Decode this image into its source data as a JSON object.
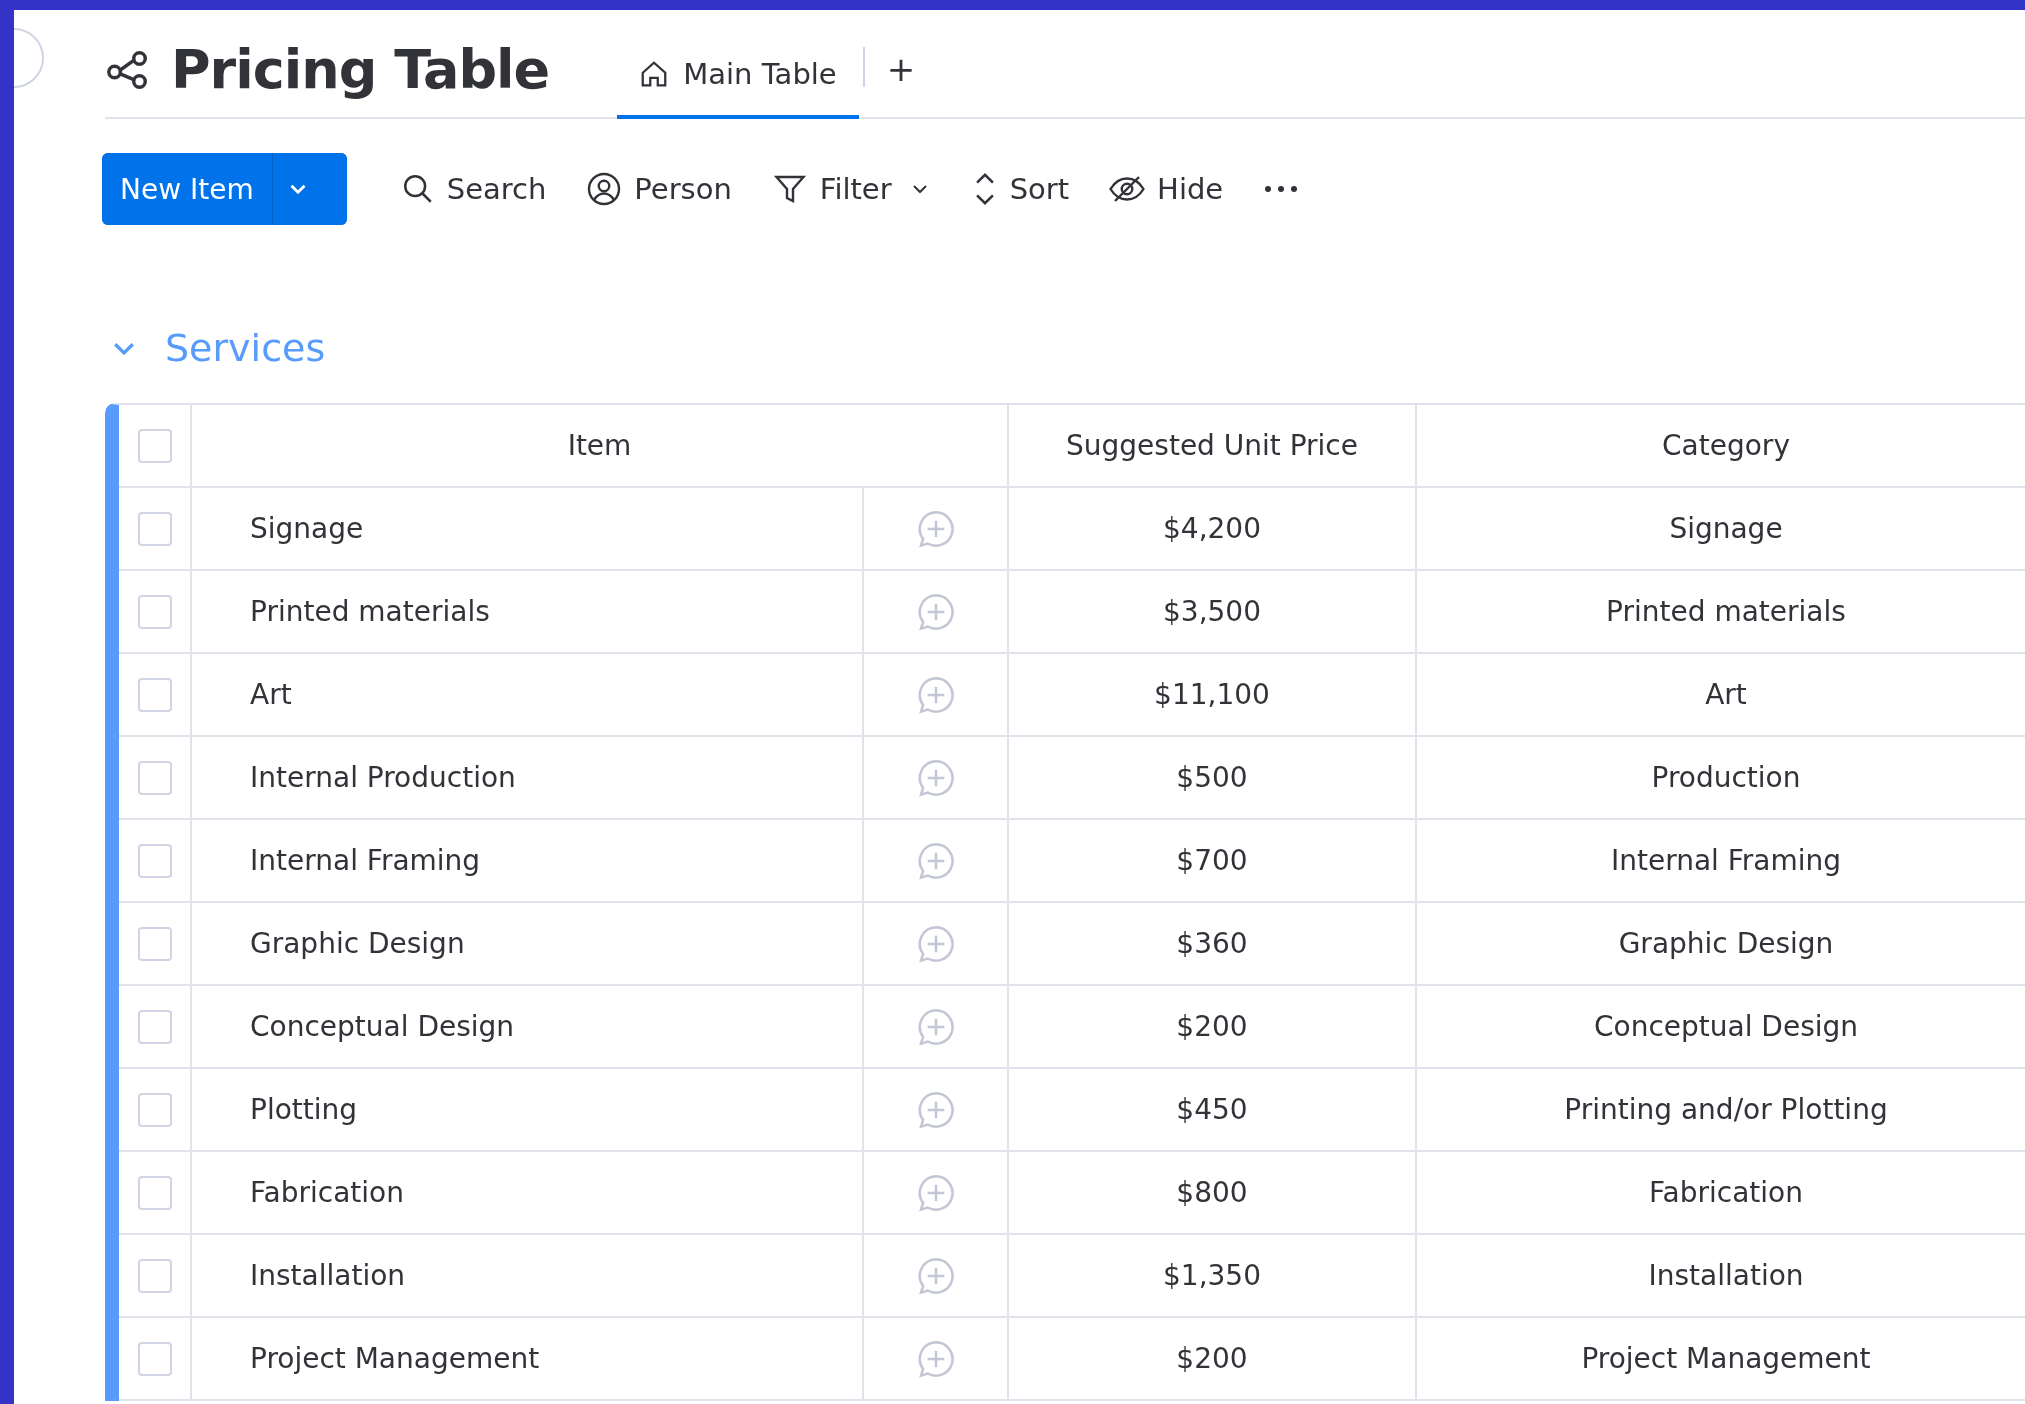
{
  "board": {
    "title": "Pricing Table"
  },
  "views": [
    {
      "label": "Main Table",
      "selected": true
    }
  ],
  "add_view": "+",
  "toolbar": {
    "new_item": "New Item",
    "tools": [
      {
        "kind": "search",
        "label": "Search"
      },
      {
        "kind": "person",
        "label": "Person"
      },
      {
        "kind": "filter",
        "label": "Filter"
      },
      {
        "kind": "sort",
        "label": "Sort"
      },
      {
        "kind": "hide",
        "label": "Hide"
      },
      {
        "kind": "more"
      }
    ]
  },
  "group": {
    "title": "Services",
    "expanded": true,
    "color": "#579bfc"
  },
  "table": {
    "select_all_checked": false,
    "columns": [
      "Item",
      "Suggested Unit Price",
      "Category"
    ],
    "rows": [
      {
        "item": "Signage",
        "price": "$4,200",
        "category": "Signage",
        "checked": false
      },
      {
        "item": "Printed materials",
        "price": "$3,500",
        "category": "Printed materials",
        "checked": false
      },
      {
        "item": "Art",
        "price": "$11,100",
        "category": "Art",
        "checked": false
      },
      {
        "item": "Internal Production",
        "price": "$500",
        "category": "Production",
        "checked": false
      },
      {
        "item": "Internal Framing",
        "price": "$700",
        "category": "Internal Framing",
        "checked": false
      },
      {
        "item": "Graphic Design",
        "price": "$360",
        "category": "Graphic Design",
        "checked": false
      },
      {
        "item": "Conceptual Design",
        "price": "$200",
        "category": "Conceptual Design",
        "checked": false
      },
      {
        "item": "Plotting",
        "price": "$450",
        "category": "Printing and/or Plotting",
        "checked": false
      },
      {
        "item": "Fabrication",
        "price": "$800",
        "category": "Fabrication",
        "checked": false
      },
      {
        "item": "Installation",
        "price": "$1,350",
        "category": "Installation",
        "checked": false
      },
      {
        "item": "Project Management",
        "price": "$200",
        "category": "Project Management",
        "checked": false
      }
    ]
  }
}
